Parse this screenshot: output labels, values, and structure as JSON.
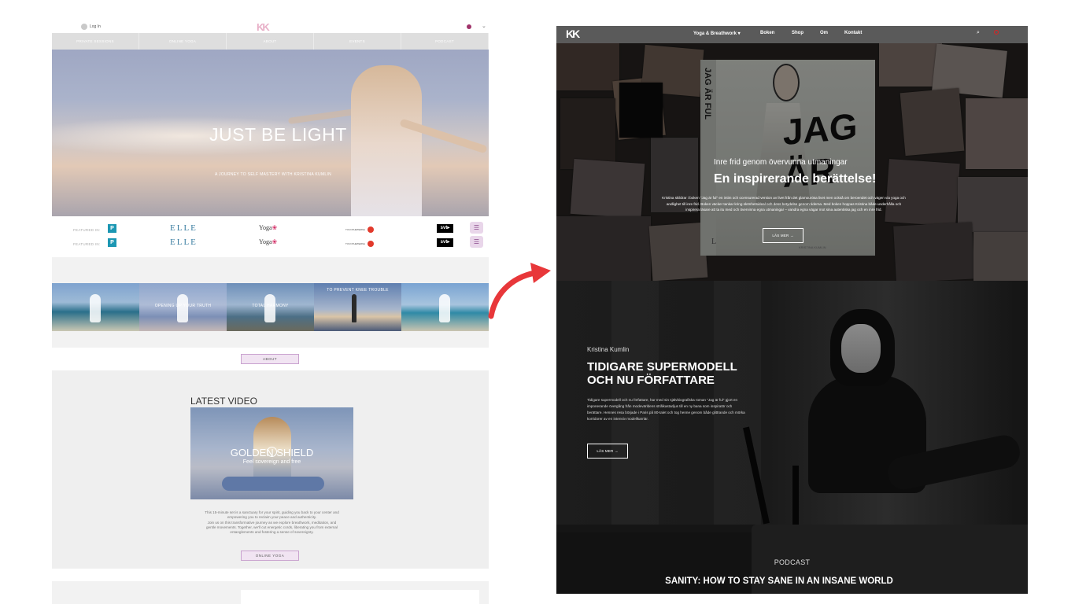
{
  "left_site": {
    "topbar": {
      "login": "Log In",
      "chevron": "⌄"
    },
    "nav": [
      "PRIVATE SESSIONS",
      "ONLINE YOGA",
      "ABOUT",
      "EVENTS",
      "PODCAST"
    ],
    "hero": {
      "title": "JUST BE LIGHT",
      "subtitle": "A JOURNEY TO SELF MASTERY WITH KRISTINA KUMLIN"
    },
    "featured": {
      "label": "FEATURED IN:",
      "logos": {
        "p": "P",
        "elle": "ELLE",
        "yoga": "Yoga",
        "tv": "TV4 NYHETERNA",
        "svt": "svt▸"
      }
    },
    "thumbnails": [
      "",
      "OPENING UP YOUR TRUTH",
      "TOTAL HARMONY",
      "TO PREVENT KNEE TROUBLE",
      ""
    ],
    "about_button": "ABOUT",
    "latest": {
      "title": "LATEST VIDEO",
      "video_title": "GOLDEN SHIELD",
      "video_subtitle": "Feel sovereign and free",
      "text_lines": [
        "This 15-minute set is a sanctuary for your spirit, guiding you back to your center and",
        "empowering you to reclaim your peace and authenticity.",
        "Join us on this transformative journey as we explore breathwork, meditation, and",
        "gentle movements. Together, we'll cut energetic cords, liberating you from external",
        "entanglements and fostering a sense of sovereignty."
      ],
      "button": "ONLINE YOGA"
    }
  },
  "right_site": {
    "nav": {
      "logo": "KK",
      "items": [
        "Yoga & Breathwork ▾",
        "Boken",
        "Shop",
        "Om",
        "Kontakt"
      ],
      "search": "⌕"
    },
    "book": {
      "spine_text": "JAG ÄR FUL",
      "cover_text": "JAG ÄR",
      "l_mark": "L",
      "author": "KRISTINA KUMLIN"
    },
    "hero": {
      "subtitle": "Inre frid genom övervunna utmaningar",
      "title": "En inspirerande berättelse!",
      "text": "Kristina skildrar i boken \"Jag är ful\" en intim och ocensurerad version av livet från det glamourösa livet men också om beroendet och vägen via yoga och andlighet till inre frid. Boken väcker tankar kring skönhetsideal och dess betydelse genom tiderna. Med boken hoppas Kristina både underhålla och inspirera läsare att ta itu med och övervinna egna utmaningar – vandra egna vägar mot sina autentiska jag och en inre frid.",
      "button": "LÄS MER →"
    },
    "about": {
      "name": "Kristina Kumlin",
      "title_line1": "TIDIGARE SUPERMODELL",
      "title_line2": "OCH NU FÖRFATTARE",
      "text": "Tidigare supermodell och nu författare, har med sin självbiografiska roman \"Jag är ful\" gjort en imponerande övergång från modevärldens strålkastarljus till en ny bana som inspiratör och berättare. Hennes resa började i Paris på 80-talet och tog henne genom både glittrande och mörka korridorer av en intensiv modellkarriär.",
      "button": "LÄS MER →"
    },
    "podcast": {
      "label": "PODCAST",
      "title": "SANITY: HOW TO STAY SANE IN AN INSANE WORLD"
    }
  },
  "colors": {
    "accent_pink": "#e8b0c8",
    "button_lilac": "#f1e4f2",
    "arrow_red": "#e8373a",
    "dark_bg": "#0b0b0b"
  }
}
